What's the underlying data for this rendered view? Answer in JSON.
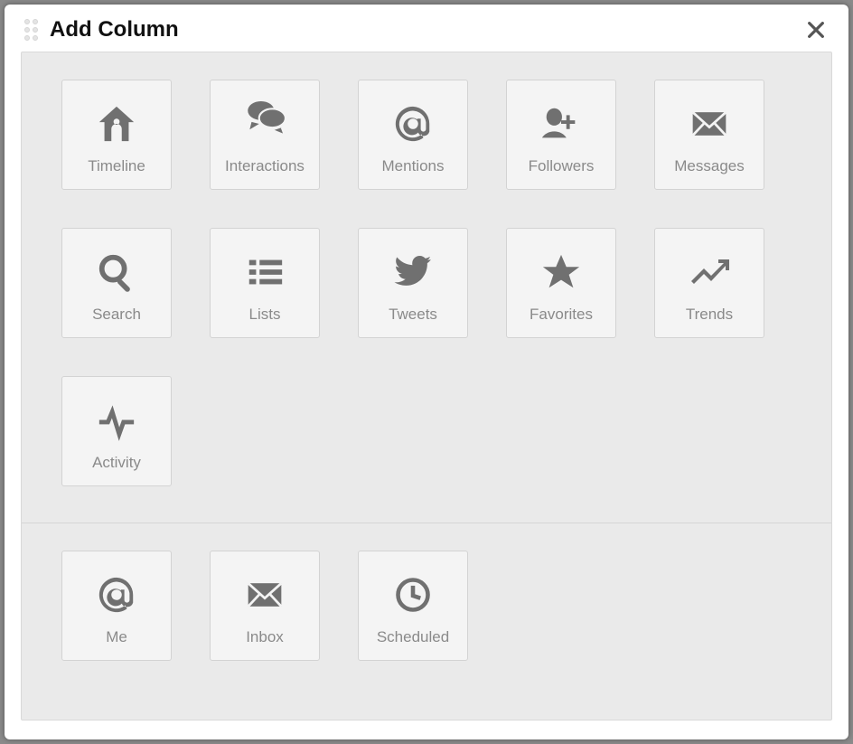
{
  "modal": {
    "title": "Add Column"
  },
  "sections": {
    "main": [
      {
        "label": "Timeline",
        "icon": "home-icon"
      },
      {
        "label": "Interactions",
        "icon": "chat-icon"
      },
      {
        "label": "Mentions",
        "icon": "at-icon"
      },
      {
        "label": "Followers",
        "icon": "add-user-icon"
      },
      {
        "label": "Messages",
        "icon": "envelope-icon"
      },
      {
        "label": "Search",
        "icon": "search-icon"
      },
      {
        "label": "Lists",
        "icon": "list-icon"
      },
      {
        "label": "Tweets",
        "icon": "bird-icon"
      },
      {
        "label": "Favorites",
        "icon": "star-icon"
      },
      {
        "label": "Trends",
        "icon": "trend-icon"
      },
      {
        "label": "Activity",
        "icon": "activity-icon"
      }
    ],
    "secondary": [
      {
        "label": "Me",
        "icon": "at-icon"
      },
      {
        "label": "Inbox",
        "icon": "envelope-icon"
      },
      {
        "label": "Scheduled",
        "icon": "clock-icon"
      }
    ]
  }
}
